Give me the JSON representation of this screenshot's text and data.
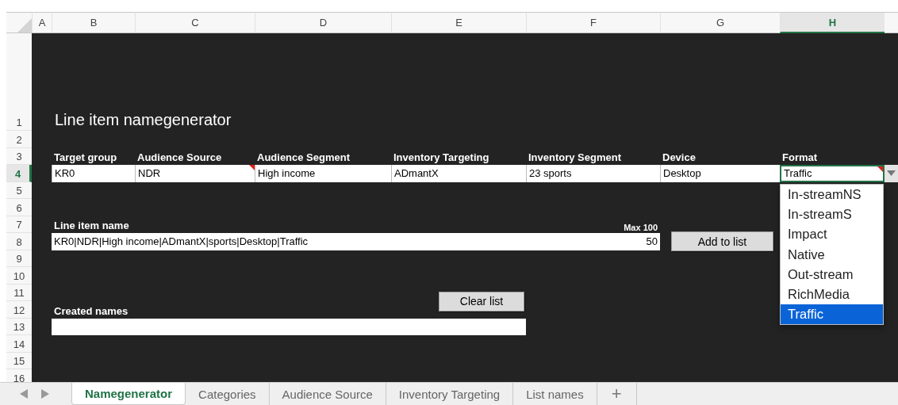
{
  "columns": [
    {
      "label": "A",
      "selected": false
    },
    {
      "label": "B",
      "selected": false
    },
    {
      "label": "C",
      "selected": false
    },
    {
      "label": "D",
      "selected": false
    },
    {
      "label": "E",
      "selected": false
    },
    {
      "label": "F",
      "selected": false
    },
    {
      "label": "G",
      "selected": false
    },
    {
      "label": "H",
      "selected": true
    }
  ],
  "rows": [
    {
      "label": "1",
      "selected": false
    },
    {
      "label": "2",
      "selected": false
    },
    {
      "label": "3",
      "selected": false
    },
    {
      "label": "4",
      "selected": true
    },
    {
      "label": "5",
      "selected": false
    },
    {
      "label": "6",
      "selected": false
    },
    {
      "label": "7",
      "selected": false
    },
    {
      "label": "8",
      "selected": false
    },
    {
      "label": "9",
      "selected": false
    },
    {
      "label": "10",
      "selected": false
    },
    {
      "label": "11",
      "selected": false
    },
    {
      "label": "12",
      "selected": false
    },
    {
      "label": "13",
      "selected": false
    },
    {
      "label": "14",
      "selected": false
    },
    {
      "label": "15",
      "selected": false
    },
    {
      "label": "16",
      "selected": false
    }
  ],
  "title": "Line item namegenerator",
  "fields": [
    {
      "label": "Target group",
      "value": "KR0",
      "comment": false,
      "selected": false
    },
    {
      "label": "Audience Source",
      "value": "NDR",
      "comment": true,
      "selected": false
    },
    {
      "label": "Audience Segment",
      "value": "High income",
      "comment": false,
      "selected": false
    },
    {
      "label": "Inventory Targeting",
      "value": "ADmantX",
      "comment": false,
      "selected": false
    },
    {
      "label": "Inventory Segment",
      "value": "23 sports",
      "comment": false,
      "selected": false
    },
    {
      "label": "Device",
      "value": "Desktop",
      "comment": false,
      "selected": false
    },
    {
      "label": "Format",
      "value": "Traffic",
      "comment": true,
      "selected": true
    }
  ],
  "line_item": {
    "label": "Line item name",
    "value": "KR0|NDR|High income|ADmantX|sports|Desktop|Traffic",
    "max_label": "Max 100",
    "count": "50"
  },
  "add_button": "Add to list",
  "clear_button": "Clear list",
  "created_names": {
    "label": "Created names"
  },
  "dropdown": {
    "options": [
      {
        "label": "In-streamNS",
        "selected": false
      },
      {
        "label": "In-streamS",
        "selected": false
      },
      {
        "label": "Impact",
        "selected": false
      },
      {
        "label": "Native",
        "selected": false
      },
      {
        "label": "Out-stream",
        "selected": false
      },
      {
        "label": "RichMedia",
        "selected": false
      },
      {
        "label": "Traffic",
        "selected": true
      }
    ]
  },
  "sheet_tabs": [
    {
      "label": "Namegenerator",
      "selected": true
    },
    {
      "label": "Categories",
      "selected": false
    },
    {
      "label": "Audience Source",
      "selected": false
    },
    {
      "label": "Inventory Targeting",
      "selected": false
    },
    {
      "label": "List names",
      "selected": false
    }
  ],
  "add_sheet": "+"
}
